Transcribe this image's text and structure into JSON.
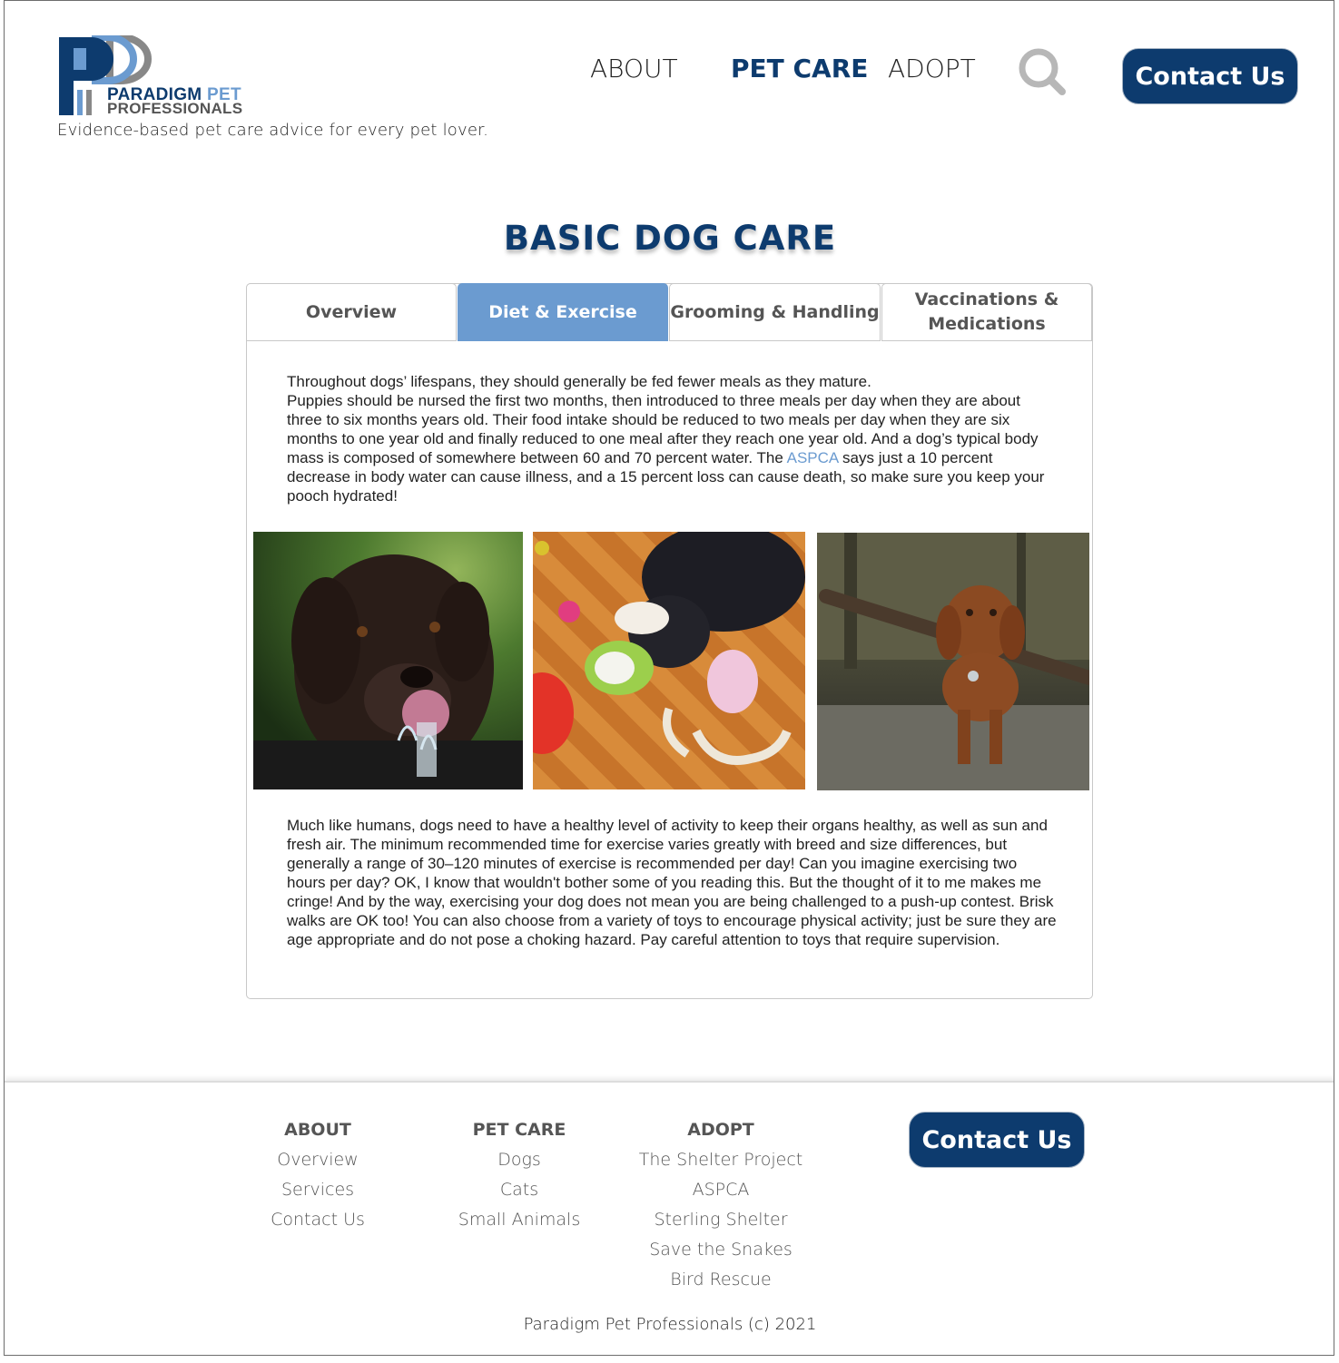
{
  "header": {
    "logo_line1_a": "PARADIGM",
    "logo_line1_b": "PET",
    "logo_line2": "PROFESSIONALS",
    "tagline": "Evidence-based pet care advice for every pet lover.",
    "nav": [
      "ABOUT",
      "PET CARE",
      "ADOPT"
    ],
    "active_nav": "PET CARE",
    "search_icon": "search-icon",
    "contact_label": "Contact Us"
  },
  "main": {
    "title": "BASIC DOG CARE",
    "tabs": [
      {
        "label": "Overview",
        "active": false
      },
      {
        "label": "Diet & Exercise",
        "active": true
      },
      {
        "label": "Grooming & Handling",
        "active": false
      },
      {
        "label": "Vaccinations & Medications",
        "active": false
      }
    ],
    "para1_line1": "Throughout dogs’ lifespans, they should generally be fed fewer meals as they mature.",
    "para1_body_a": "Puppies should be nursed the first two months, then introduced to three meals per day when they are about three to six months years old. Their food intake should be reduced to two meals per day when they are six months to one year old and finally reduced to one meal after they reach one year old. And a dog’s typical body mass is composed of somewhere between 60 and 70 percent water. The ",
    "para1_link": "ASPCA",
    "para1_body_b": " says just a 10 percent decrease in body water can cause illness, and a 15 percent loss can cause death, so make sure you keep your pooch hydrated!",
    "para2": "Much like humans, dogs need to have a healthy level of activity to keep their organs healthy, as well as sun and fresh air. The minimum recommended time for exercise varies greatly with breed and size differences, but generally a range of 30–120 minutes of exercise is recommended per day! Can you imagine exercising two hours per day? OK, I know that wouldn't bother some of you reading this. But the thought of it to me makes me cringe! And by the way, exercising your dog does not mean you are being challenged to a push-up contest. Brisk walks are OK too! You can also choose from a variety of toys to encourage physical activity; just be sure they are age appropriate and do not pose a choking hazard. Pay careful attention to toys that require supervision."
  },
  "footer": {
    "columns": [
      {
        "heading": "ABOUT",
        "items": [
          "Overview",
          "Services",
          "Contact Us"
        ]
      },
      {
        "heading": "PET CARE",
        "items": [
          "Dogs",
          "Cats",
          "Small Animals"
        ]
      },
      {
        "heading": "ADOPT",
        "items": [
          "The Shelter Project",
          "ASPCA",
          "Sterling Shelter",
          "Save the Snakes",
          "Bird Rescue"
        ]
      }
    ],
    "contact_label": "Contact Us",
    "copyright": "Paradigm Pet Professionals (c) 2021"
  },
  "colors": {
    "brand_navy": "#0d3b6e",
    "accent_blue": "#6b9bd0",
    "tab_active_bg": "#6b9bd0"
  }
}
